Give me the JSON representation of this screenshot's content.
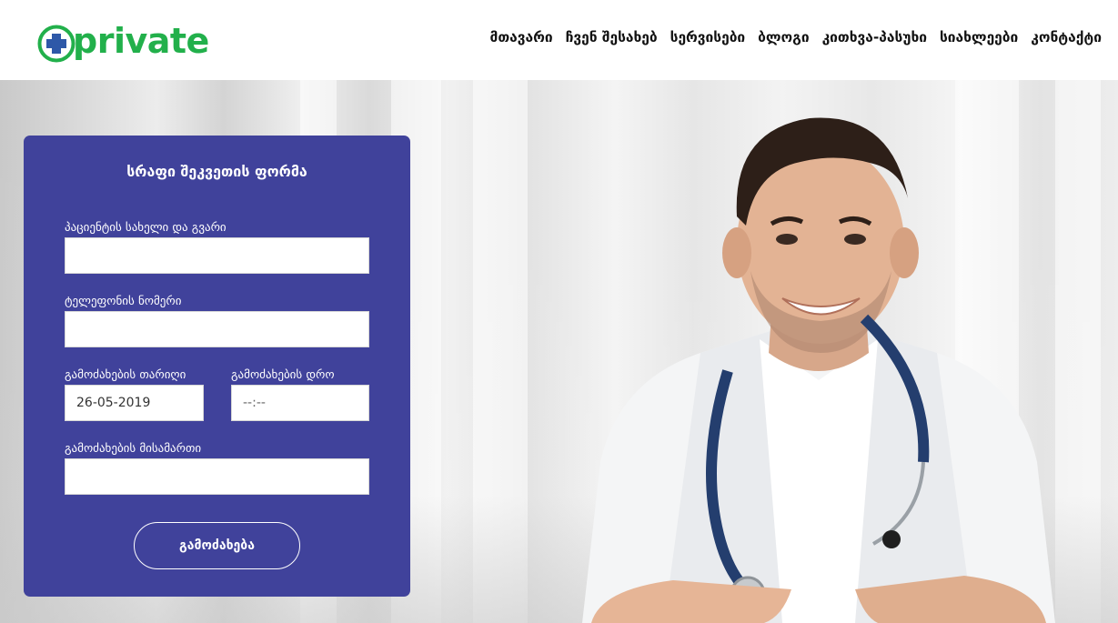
{
  "header": {
    "logo_text": "private",
    "nav": [
      "მთავარი",
      "ჩვენ შესახებ",
      "სერვისები",
      "ბლოგი",
      "კითხვა-პასუხი",
      "სიახლეები",
      "კონტაქტი"
    ]
  },
  "form": {
    "title": "სრაფი შეკვეთის ფორმა",
    "patient_name_label": "პაციენტის სახელი და გვარი",
    "patient_name_value": "",
    "phone_label": "ტელეფონის ნომერი",
    "phone_value": "",
    "date_label": "გამოძახების თარიღი",
    "date_value": "26-05-2019",
    "time_label": "გამოძახების დრო",
    "time_value": "--:--",
    "address_label": "გამოძახების მისამართი",
    "address_value": "",
    "submit_label": "გამოძახება"
  },
  "colors": {
    "brand_green": "#22b04b",
    "brand_blue": "#2e58a8",
    "panel": "#40429b"
  }
}
